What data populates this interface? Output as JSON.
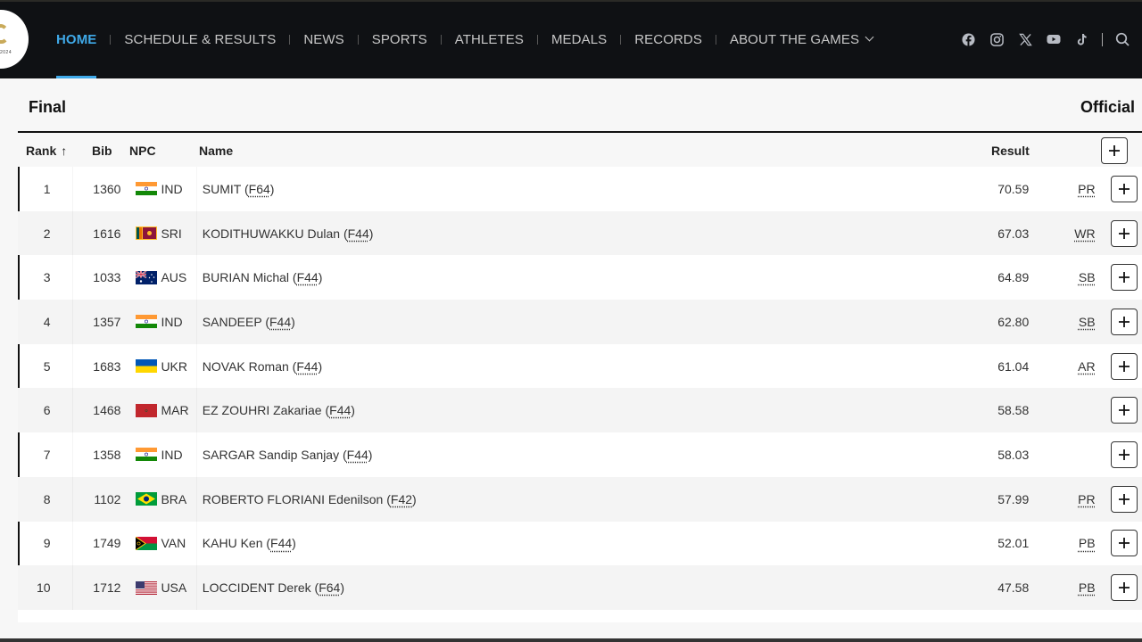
{
  "nav": {
    "items": [
      {
        "label": "HOME",
        "active": true
      },
      {
        "label": "SCHEDULE & RESULTS"
      },
      {
        "label": "NEWS"
      },
      {
        "label": "SPORTS"
      },
      {
        "label": "ATHLETES"
      },
      {
        "label": "MEDALS"
      },
      {
        "label": "RECORDS"
      },
      {
        "label": "ABOUT THE GAMES"
      }
    ],
    "logo_text": "2024",
    "social": [
      "facebook-icon",
      "instagram-icon",
      "x-icon",
      "youtube-icon",
      "tiktok-icon"
    ],
    "accent": "#3fa9e8"
  },
  "section": {
    "title": "Final",
    "status": "Official"
  },
  "table": {
    "headers": {
      "rank": "Rank",
      "rank_sort": "↑",
      "bib": "Bib",
      "npc": "NPC",
      "name": "Name",
      "result": "Result"
    },
    "rows": [
      {
        "rank": "1",
        "bib": "1360",
        "npc": "IND",
        "name": "SUMIT (",
        "cls": "F64",
        "result": "70.59",
        "tag": "PR"
      },
      {
        "rank": "2",
        "bib": "1616",
        "npc": "SRI",
        "name": "KODITHUWAKKU Dulan (",
        "cls": "F44",
        "result": "67.03",
        "tag": "WR"
      },
      {
        "rank": "3",
        "bib": "1033",
        "npc": "AUS",
        "name": "BURIAN Michal (",
        "cls": "F44",
        "result": "64.89",
        "tag": "SB"
      },
      {
        "rank": "4",
        "bib": "1357",
        "npc": "IND",
        "name": "SANDEEP (",
        "cls": "F44",
        "result": "62.80",
        "tag": "SB"
      },
      {
        "rank": "5",
        "bib": "1683",
        "npc": "UKR",
        "name": "NOVAK Roman (",
        "cls": "F44",
        "result": "61.04",
        "tag": "AR"
      },
      {
        "rank": "6",
        "bib": "1468",
        "npc": "MAR",
        "name": "EZ ZOUHRI Zakariae (",
        "cls": "F44",
        "result": "58.58",
        "tag": ""
      },
      {
        "rank": "7",
        "bib": "1358",
        "npc": "IND",
        "name": "SARGAR Sandip Sanjay (",
        "cls": "F44",
        "result": "58.03",
        "tag": ""
      },
      {
        "rank": "8",
        "bib": "1102",
        "npc": "BRA",
        "name": "ROBERTO FLORIANI Edenilson (",
        "cls": "F42",
        "result": "57.99",
        "tag": "PR"
      },
      {
        "rank": "9",
        "bib": "1749",
        "npc": "VAN",
        "name": "KAHU Ken (",
        "cls": "F44",
        "result": "52.01",
        "tag": "PB"
      },
      {
        "rank": "10",
        "bib": "1712",
        "npc": "USA",
        "name": "LOCCIDENT Derek (",
        "cls": "F64",
        "result": "47.58",
        "tag": "PB"
      }
    ]
  }
}
